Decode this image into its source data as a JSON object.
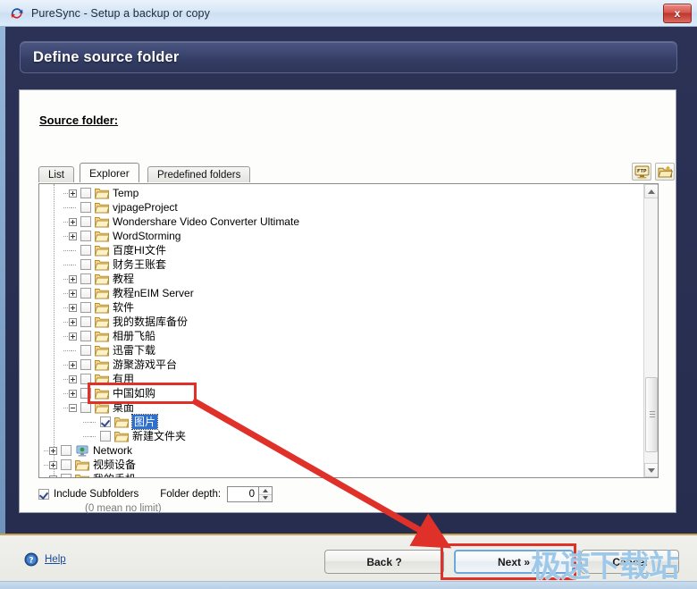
{
  "window": {
    "title": "PureSync - Setup a backup or copy",
    "app_icon": "puresync-arrow-icon",
    "close_label": "x"
  },
  "header": {
    "banner_title": "Define source folder"
  },
  "main": {
    "source_label": "Source folder:",
    "tabs": [
      {
        "label": "List",
        "active": false
      },
      {
        "label": "Explorer",
        "active": true
      },
      {
        "label": "Predefined folders",
        "active": false
      }
    ],
    "toolbar": [
      {
        "name": "ftp-button",
        "icon": "ftp-icon",
        "label": "FTP"
      },
      {
        "name": "new-folder-button",
        "icon": "new-folder-icon",
        "label": ""
      }
    ],
    "tree": [
      {
        "label": "Temp",
        "indent": 1,
        "expander": "plus",
        "checked": false,
        "icon": "folder-icon",
        "selected": false
      },
      {
        "label": "vjpageProject",
        "indent": 1,
        "expander": "none",
        "checked": false,
        "icon": "folder-icon",
        "selected": false
      },
      {
        "label": "Wondershare Video Converter Ultimate",
        "indent": 1,
        "expander": "plus",
        "checked": false,
        "icon": "folder-icon",
        "selected": false
      },
      {
        "label": "WordStorming",
        "indent": 1,
        "expander": "plus",
        "checked": false,
        "icon": "folder-icon",
        "selected": false
      },
      {
        "label": "百度HI文件",
        "indent": 1,
        "expander": "none",
        "checked": false,
        "icon": "folder-icon",
        "selected": false
      },
      {
        "label": "财务王账套",
        "indent": 1,
        "expander": "none",
        "checked": false,
        "icon": "folder-icon",
        "selected": false
      },
      {
        "label": "教程",
        "indent": 1,
        "expander": "plus",
        "checked": false,
        "icon": "folder-icon",
        "selected": false
      },
      {
        "label": "教程nEIM Server",
        "indent": 1,
        "expander": "plus",
        "checked": false,
        "icon": "folder-icon",
        "selected": false
      },
      {
        "label": "软件",
        "indent": 1,
        "expander": "plus",
        "checked": false,
        "icon": "folder-icon",
        "selected": false
      },
      {
        "label": "我的数据库备份",
        "indent": 1,
        "expander": "plus",
        "checked": false,
        "icon": "folder-icon",
        "selected": false
      },
      {
        "label": "相册飞船",
        "indent": 1,
        "expander": "plus",
        "checked": false,
        "icon": "folder-icon",
        "selected": false
      },
      {
        "label": "迅雷下载",
        "indent": 1,
        "expander": "none",
        "checked": false,
        "icon": "folder-icon",
        "selected": false
      },
      {
        "label": "游聚游戏平台",
        "indent": 1,
        "expander": "plus",
        "checked": false,
        "icon": "folder-icon",
        "selected": false
      },
      {
        "label": "有用",
        "indent": 1,
        "expander": "plus",
        "checked": false,
        "icon": "folder-icon",
        "selected": false
      },
      {
        "label": "中国如购",
        "indent": 1,
        "expander": "plus",
        "checked": false,
        "icon": "folder-icon",
        "selected": false
      },
      {
        "label": "桌面",
        "indent": 1,
        "expander": "minus",
        "checked": false,
        "icon": "folder-icon",
        "selected": false
      },
      {
        "label": "图片",
        "indent": 2,
        "expander": "none",
        "checked": true,
        "icon": "folder-icon",
        "selected": true
      },
      {
        "label": "新建文件夹",
        "indent": 2,
        "expander": "none",
        "checked": false,
        "icon": "folder-icon",
        "selected": false
      },
      {
        "label": "Network",
        "indent": 0,
        "expander": "plus",
        "checked": false,
        "icon": "network-icon",
        "selected": false
      },
      {
        "label": "视频设备",
        "indent": 0,
        "expander": "plus",
        "checked": false,
        "icon": "folder-icon",
        "selected": false
      },
      {
        "label": "我的手机",
        "indent": 0,
        "expander": "plus",
        "checked": false,
        "icon": "folder-icon",
        "selected": false
      }
    ],
    "options": {
      "include_subfolders_label": "Include Subfolders",
      "include_subfolders_checked": true,
      "folder_depth_label": "Folder depth:",
      "folder_depth_value": "0",
      "folder_depth_hint": "(0 mean no limit)"
    }
  },
  "footer": {
    "help_label": "Help",
    "help_icon": "help-circle-icon",
    "back_label": "Back ?",
    "next_label": "Next »",
    "cancel_label": "Cancel"
  },
  "annotations": {
    "watermark_text": "极速下载站",
    "highlight_color": "#e0302a",
    "watermark_color": "#9ec8e8"
  }
}
